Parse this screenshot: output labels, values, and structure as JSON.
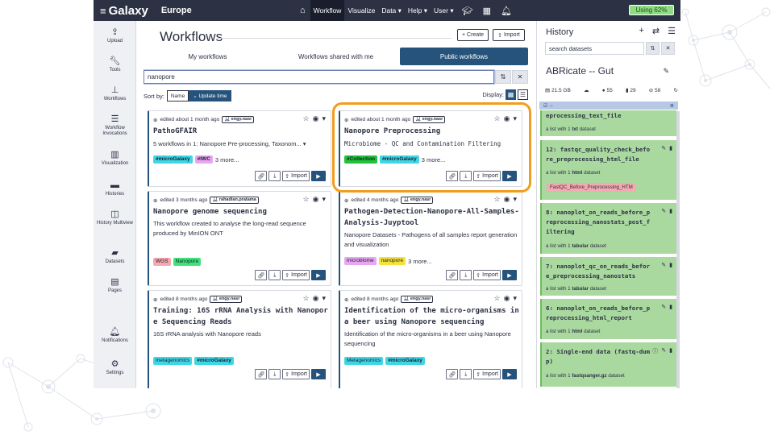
{
  "masthead": {
    "brand": "Galaxy",
    "brand_sub": "Europe",
    "links": [
      "Workflow",
      "Visualize",
      "Data ▾",
      "Help ▾",
      "User ▾"
    ],
    "quota": "Using 62%"
  },
  "activity_bar": [
    "Upload",
    "Tools",
    "Workflows",
    "Workflow Invocations",
    "Visualization",
    "Histories",
    "History Multiview",
    "Datasets",
    "Pages",
    "Notifications",
    "Settings"
  ],
  "page": {
    "title": "Workflows",
    "create_label": "Create",
    "import_label": "Import",
    "tabs": [
      "My workflows",
      "Workflows shared with me",
      "Public workflows"
    ],
    "search_value": "nanopore",
    "sort_label": "Sort by:",
    "sort_options": [
      "Name",
      "Update time"
    ],
    "display_label": "Display:"
  },
  "cards": [
    {
      "edited": "edited about 1 month ago",
      "owner": "engy.nasr",
      "name": "PathoGFAIR",
      "desc": "5 workflows in 1: Nanopore Pre-processing, Taxonom... ▾",
      "tags": [
        {
          "text": "#microGalaxy",
          "color": "#3fd7e6"
        },
        {
          "text": "#IWC",
          "color": "#e9a6f2"
        }
      ],
      "more": "3 more...",
      "import": "Import"
    },
    {
      "edited": "edited about 1 month ago",
      "owner": "engy.nasr",
      "name": "Nanopore Preprocessing",
      "desc": "Microbiome - QC and Contamination Filtering",
      "tags": [
        {
          "text": "#Collection",
          "color": "#22c33b"
        },
        {
          "text": "#microGalaxy",
          "color": "#3fd7e6"
        }
      ],
      "more": "3 more...",
      "import": "Import"
    },
    {
      "edited": "edited 3 months ago",
      "owner": "rahadian.pratama",
      "name": "Nanopore genome sequencing",
      "desc": "This workflow created to analyse the long-read sequence produced by MinION ONT",
      "tags": [
        {
          "text": "WGS",
          "color": "#f5a9b1"
        },
        {
          "text": "Nanopore",
          "color": "#3fe37a"
        }
      ],
      "more": "",
      "import": "Import"
    },
    {
      "edited": "edited 4 months ago",
      "owner": "engy.nasr",
      "name": "Pathogen-Detection-Nanopore-All-Samples-Analysis-Juyptool",
      "desc": "Nanopore Datasets - Pathogens of all samples report generation and visualization",
      "tags": [
        {
          "text": "microblome",
          "color": "#e9a6f2"
        },
        {
          "text": "nanopore",
          "color": "#f5e23a"
        }
      ],
      "more": "3 more...",
      "import": "Import"
    },
    {
      "edited": "edited 8 months ago",
      "owner": "engy.nasr",
      "name": "Training: 16S rRNA Analysis with Nanopore Sequencing Reads",
      "desc": "16S rRNA analysis with Nanopore reads",
      "tags": [
        {
          "text": "metagenomics",
          "color": "#3fd7e6"
        },
        {
          "text": "#microGalaxy",
          "color": "#3fd7e6"
        }
      ],
      "more": "",
      "import": "Import"
    },
    {
      "edited": "edited 8 months ago",
      "owner": "engy.nasr",
      "name": "Identification of the micro-organisms in a beer using Nanopore sequencing",
      "desc": "Identification of the micro-organisms in a beer using Nanopore sequencing",
      "tags": [
        {
          "text": "Metagenomics",
          "color": "#3fd7e6"
        },
        {
          "text": "#microGalaxy",
          "color": "#3fd7e6"
        }
      ],
      "more": "",
      "import": "Import"
    }
  ],
  "history": {
    "title": "History",
    "search_placeholder": "search datasets",
    "name": "ABRicate -- Gut",
    "size": "21.5 GB",
    "shown": "55",
    "deleted": "29",
    "hidden": "58",
    "datasets": [
      {
        "title": "eprocessing_text_file",
        "sub_pre": "a list with 1 ",
        "sub_type": "txt",
        "sub_post": " dataset",
        "tag": ""
      },
      {
        "title": "12: fastqc_quality_check_before_preprocessing_html_file",
        "sub_pre": "a list with 1 ",
        "sub_type": "html",
        "sub_post": " dataset",
        "tag": "FastQC_Before_Preprocessing_HTM"
      },
      {
        "title": "8: nanoplot_on_reads_before_preprocessing_nanostats_post_filtering",
        "sub_pre": "a list with 1 ",
        "sub_type": "tabular",
        "sub_post": " dataset",
        "tag": ""
      },
      {
        "title": "7: nanoplot_qc_on_reads_before_preprocessing_nanostats",
        "sub_pre": "a list with 1 ",
        "sub_type": "tabular",
        "sub_post": " dataset",
        "tag": ""
      },
      {
        "title": "6: nanoplot_on_reads_before_preprocessing_html_report",
        "sub_pre": "a list with 1 ",
        "sub_type": "html",
        "sub_post": " dataset",
        "tag": ""
      },
      {
        "title": "2: Single-end data (fastq-dump)",
        "sub_pre": "a list with 1 ",
        "sub_type": "fastqsanger.gz",
        "sub_post": " dataset",
        "tag": ""
      }
    ]
  },
  "colors": {
    "masthead": "#2c3143",
    "accent": "#25537b",
    "highlight": "#f29d1d",
    "dataset_ok": "#aad9a0",
    "quota": "#8fdc84"
  }
}
